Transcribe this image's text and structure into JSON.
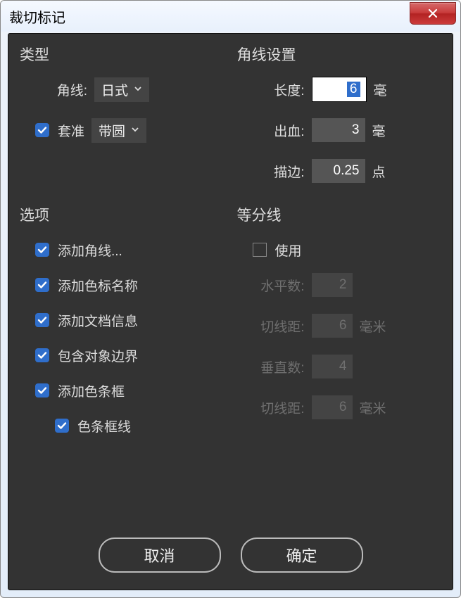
{
  "window": {
    "title": "裁切标记"
  },
  "type": {
    "title": "类型",
    "corner_label": "角线:",
    "corner_value": "日式",
    "reg_label": "套准",
    "reg_value": "带圆"
  },
  "corner": {
    "title": "角线设置",
    "length_label": "长度:",
    "length_value": "6",
    "length_unit": "毫",
    "bleed_label": "出血:",
    "bleed_value": "3",
    "bleed_unit": "毫",
    "stroke_label": "描边:",
    "stroke_value": "0.25",
    "stroke_unit": "点"
  },
  "options": {
    "title": "选项",
    "add_corner": "添加角线...",
    "add_swatch_name": "添加色标名称",
    "add_doc_info": "添加文档信息",
    "include_bounds": "包含对象边界",
    "add_color_bar": "添加色条框",
    "color_bar_line": "色条框线"
  },
  "divide": {
    "title": "等分线",
    "use_label": "使用",
    "hcount_label": "水平数:",
    "hcount_value": "2",
    "hcut_label": "切线距:",
    "hcut_value": "6",
    "hcut_unit": "毫米",
    "vcount_label": "垂直数:",
    "vcount_value": "4",
    "vcut_label": "切线距:",
    "vcut_value": "6",
    "vcut_unit": "毫米"
  },
  "buttons": {
    "cancel": "取消",
    "ok": "确定"
  }
}
